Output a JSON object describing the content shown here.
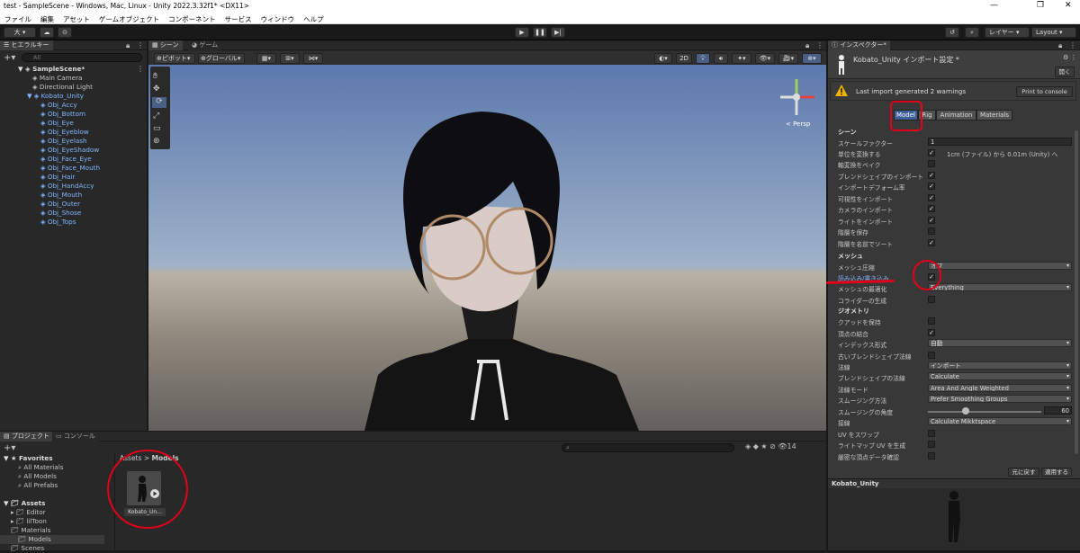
{
  "window": {
    "title": "test - SampleScene - Windows, Mac, Linux - Unity 2022.3.32f1* <DX11>",
    "min": "—",
    "max": "❐",
    "close": "✕"
  },
  "menu": [
    "ファイル",
    "編集",
    "アセット",
    "ゲームオブジェクト",
    "コンポーネント",
    "サービス",
    "ウィンドウ",
    "ヘルプ"
  ],
  "toolbar": {
    "account": "大 ▾",
    "layers": "レイヤー",
    "layout": "Layout"
  },
  "hierarchy": {
    "tab": "ヒエラルキー",
    "search_placeholder": "All",
    "scene": "SampleScene*",
    "items": [
      "Main Camera",
      "Directional Light",
      "Kobato_Unity",
      "Obj_Accy",
      "Obj_Bottom",
      "Obj_Eye",
      "Obj_Eyeblow",
      "Obj_Eyelash",
      "Obj_EyeShadow",
      "Obj_Face_Eye",
      "Obj_Face_Mouth",
      "Obj_Hair",
      "Obj_HandAccy",
      "Obj_Mouth",
      "Obj_Outer",
      "Obj_Shose",
      "Obj_Tops"
    ]
  },
  "scene": {
    "tab_scene": "シーン",
    "tab_game": "ゲーム",
    "pivot": "ピボット",
    "global": "グローバル",
    "mode2d": "2D",
    "persp": "< Persp"
  },
  "project": {
    "tab_project": "プロジェクト",
    "tab_console": "コンソール",
    "favorites": "Favorites",
    "fav_items": [
      "All Materials",
      "All Models",
      "All Prefabs"
    ],
    "assets": "Assets",
    "asset_items": [
      "Editor",
      "lilToon",
      "Materials",
      "Models",
      "Scenes"
    ],
    "breadcrumb_root": "Assets",
    "breadcrumb_sep": ">",
    "breadcrumb_leaf": "Models",
    "asset_label": "Kobato_Un...",
    "count": "14"
  },
  "inspector": {
    "tab": "インスペクター*",
    "title": "Kobato_Unity インポート設定 *",
    "open": "開く",
    "warning": "Last import generated 2 warnings",
    "print": "Print to console",
    "tabs": [
      "Model",
      "Rig",
      "Animation",
      "Materials"
    ],
    "sec_scene": "シーン",
    "sec_mesh": "メッシュ",
    "sec_geom": "ジオメトリ",
    "scale_label": "スケールファクター",
    "scale_value": "1",
    "convert_label": "単位を変換する",
    "convert_text": "1cm (ファイル) から 0.01m (Unity) へ",
    "scene_rows": [
      {
        "label": "軸変換をベイク",
        "checked": false
      },
      {
        "label": "ブレンドシェイプのインポート",
        "checked": true
      },
      {
        "label": "インポートデフォーム率",
        "checked": true
      },
      {
        "label": "可視性をインポート",
        "checked": true
      },
      {
        "label": "カメラのインポート",
        "checked": true
      },
      {
        "label": "ライトをインポート",
        "checked": true
      },
      {
        "label": "階層を保存",
        "checked": false
      },
      {
        "label": "階層を名前でソート",
        "checked": true
      }
    ],
    "mesh_compress_label": "メッシュ圧縮",
    "mesh_compress_value": "オフ",
    "rw_label": "読み込み/書き込み",
    "rw_checked": true,
    "optimize_label": "メッシュの最適化",
    "optimize_value": "Everything",
    "collider_label": "コライダーの生成",
    "quads_label": "クアッドを保持",
    "weld_label": "頂点の結合",
    "index_label": "インデックス形式",
    "index_value": "自動",
    "legacy_label": "古いブレンドシェイプ法線",
    "normals_label": "法線",
    "normals_value": "インポート",
    "bs_normals_label": "ブレンドシェイプの法線",
    "bs_normals_value": "Calculate",
    "normals_mode_label": "法線モード",
    "normals_mode_value": "Area And Angle Weighted",
    "smooth_src_label": "スムージング方法",
    "smooth_src_value": "Prefer Smoothing Groups",
    "smooth_angle_label": "スムージングの角度",
    "smooth_angle_value": "60",
    "smooth_angle_level": 0.333,
    "tangents_label": "接線",
    "tangents_value": "Calculate Mikktspace",
    "swap_label": "UV をスワップ",
    "lightmap_label": "ライトマップ UV を生成",
    "strict_label": "厳密な頂点データ確認",
    "revert": "元に戻す",
    "apply": "適用する",
    "preview_title": "Kobato_Unity"
  },
  "colors": {
    "accent": "#3d5f97",
    "annotation": "#e0001a",
    "link": "#7fb6ff"
  }
}
